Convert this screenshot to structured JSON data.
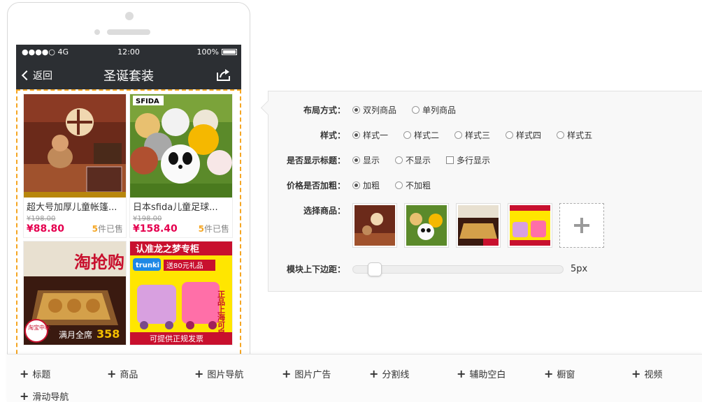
{
  "statusbar": {
    "signal": "●●●●○ 4G",
    "time": "12:00",
    "battery": "100%"
  },
  "navbar": {
    "back_label": "返回",
    "title": "圣诞套装"
  },
  "products": [
    {
      "name": "超大号加厚儿童帐篷...",
      "orig_price": "¥198.00",
      "price": "¥88.80",
      "sold_count": "5",
      "sold_suffix": "件已售"
    },
    {
      "name": "日本sfida儿童足球...",
      "orig_price": "¥198.00",
      "price": "¥158.40",
      "sold_count": "5",
      "sold_suffix": "件已售"
    },
    {
      "name": "",
      "orig_price": "",
      "price": "",
      "sold_count": "",
      "sold_suffix": ""
    },
    {
      "name": "",
      "orig_price": "",
      "price": "",
      "sold_count": "",
      "sold_suffix": ""
    }
  ],
  "image_text": {
    "sfida": "SFIDA",
    "p3_title": "淘抢购",
    "p3_badge": "淘宝中秋",
    "p3_promo": "满月全席",
    "p3_price": "358",
    "p4_banner": "认准龙之梦专柜",
    "p4_brand": "trunki",
    "p4_promo": "送80元礼品",
    "p4_side": "正品上海可自提",
    "p4_bottom": "可提供正规发票"
  },
  "panel": {
    "layout": {
      "label": "布局方式：",
      "options": [
        "双列商品",
        "单列商品"
      ],
      "selected": 0
    },
    "style": {
      "label": "样式：",
      "options": [
        "样式一",
        "样式二",
        "样式三",
        "样式四",
        "样式五"
      ],
      "selected": 0
    },
    "show_title": {
      "label": "是否显示标题：",
      "options": [
        "显示",
        "不显示"
      ],
      "selected": 0,
      "multiline_label": "多行显示"
    },
    "bold_price": {
      "label": "价格是否加粗：",
      "options": [
        "加粗",
        "不加粗"
      ],
      "selected": 0
    },
    "select_goods": {
      "label": "选择商品："
    },
    "margin": {
      "label": "模块上下边距：",
      "value": "5px"
    }
  },
  "toolbar": {
    "items": [
      "标题",
      "商品",
      "图片导航",
      "图片广告",
      "分割线",
      "辅助空白",
      "橱窗",
      "视频",
      "滑动导航"
    ]
  },
  "colors": {
    "accent_price": "#e5004f",
    "sold_highlight": "#f5a623",
    "dashed_border": "#f5a623",
    "navbar_bg": "#2c2f33"
  }
}
